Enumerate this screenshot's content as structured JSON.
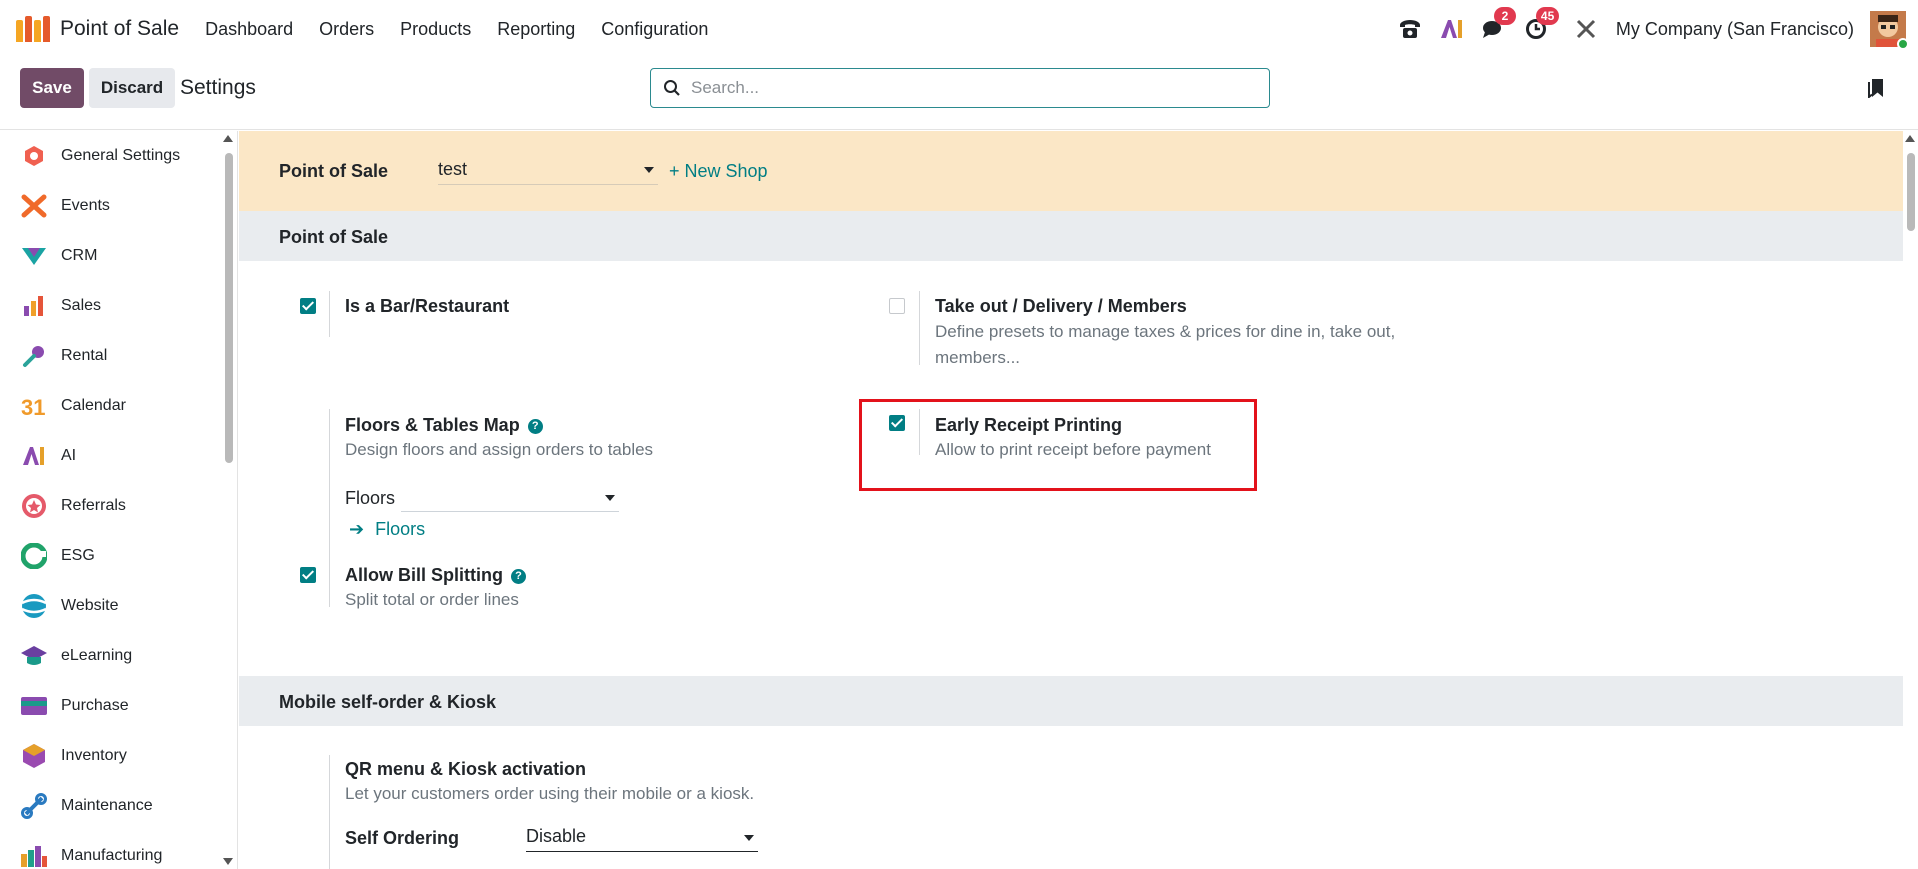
{
  "app": {
    "name": "Point of Sale",
    "menu": [
      "Dashboard",
      "Orders",
      "Products",
      "Reporting",
      "Configuration"
    ]
  },
  "systray": {
    "messages_count": "2",
    "activities_count": "45",
    "company": "My Company (San Francisco)"
  },
  "control": {
    "save_label": "Save",
    "discard_label": "Discard",
    "title": "Settings",
    "search_placeholder": "Search..."
  },
  "sidebar": {
    "items": [
      {
        "label": "General Settings",
        "icon": "general-settings-icon",
        "color": "#f06050"
      },
      {
        "label": "Events",
        "icon": "events-icon",
        "color": "#f06a2a"
      },
      {
        "label": "CRM",
        "icon": "crm-icon",
        "color": "#1aa3a3"
      },
      {
        "label": "Sales",
        "icon": "sales-icon",
        "color": "#f0a02a"
      },
      {
        "label": "Rental",
        "icon": "rental-icon",
        "color": "#2aa39a"
      },
      {
        "label": "Calendar",
        "icon": "calendar-icon",
        "color": "#f09a2a"
      },
      {
        "label": "AI",
        "icon": "ai-icon",
        "color": "#8a4baf"
      },
      {
        "label": "Referrals",
        "icon": "referrals-icon",
        "color": "#e55a6a"
      },
      {
        "label": "ESG",
        "icon": "esg-icon",
        "color": "#20a36a"
      },
      {
        "label": "Website",
        "icon": "website-icon",
        "color": "#1a9ac0"
      },
      {
        "label": "eLearning",
        "icon": "elearning-icon",
        "color": "#6a3fa0"
      },
      {
        "label": "Purchase",
        "icon": "purchase-icon",
        "color": "#1a9a8a"
      },
      {
        "label": "Inventory",
        "icon": "inventory-icon",
        "color": "#9a4ab0"
      },
      {
        "label": "Maintenance",
        "icon": "maintenance-icon",
        "color": "#2a7ac0"
      },
      {
        "label": "Manufacturing",
        "icon": "manufacturing-icon",
        "color": "#20a08a"
      }
    ]
  },
  "shop": {
    "label": "Point of Sale",
    "selected": "test",
    "new_shop": "+ New Shop"
  },
  "sections": {
    "pos": "Point of Sale",
    "mobile": "Mobile self-order & Kiosk"
  },
  "settings": {
    "bar_restaurant": {
      "title": "Is a Bar/Restaurant",
      "checked": true
    },
    "takeout": {
      "title": "Take out / Delivery / Members",
      "desc": "Define presets to manage taxes & prices for dine in, take out, members...",
      "checked": false
    },
    "floors": {
      "title": "Floors & Tables Map",
      "desc": "Design floors and assign orders to tables",
      "field_label": "Floors",
      "link": "Floors"
    },
    "early_receipt": {
      "title": "Early Receipt Printing",
      "desc": "Allow to print receipt before payment",
      "checked": true
    },
    "bill_split": {
      "title": "Allow Bill Splitting",
      "desc": "Split total or order lines",
      "checked": true
    },
    "qr_kiosk": {
      "title": "QR menu & Kiosk activation",
      "desc": "Let your customers order using their mobile or a kiosk.",
      "field_label": "Self Ordering",
      "field_value": "Disable"
    }
  },
  "colors": {
    "brand": "#714b67",
    "accent": "#017e84",
    "shop_bar": "#fbe7c6",
    "highlight": "#e3121b"
  }
}
